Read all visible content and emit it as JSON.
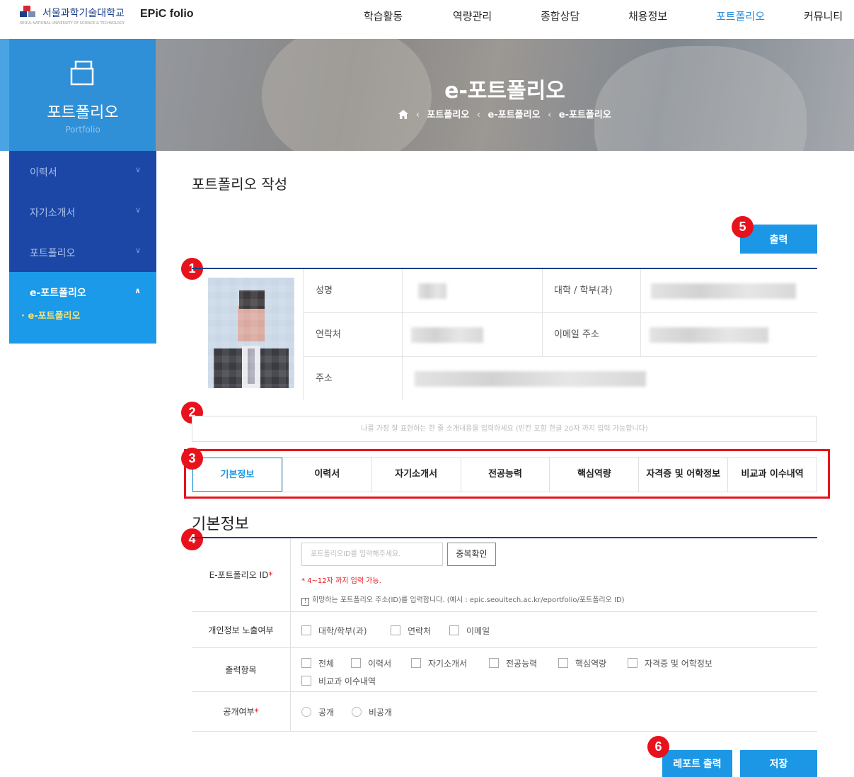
{
  "topnav": {
    "logo_text": "서울과학기술대학교",
    "logo_sub": "SEOUL NATIONAL UNIVERSITY OF SCIENCE & TECHNOLOGY",
    "brand": "EPiC folio",
    "menu": [
      "학습활동",
      "역량관리",
      "종합상담",
      "채용정보",
      "포트폴리오",
      "커뮤니티"
    ],
    "active_menu": "포트폴리오"
  },
  "sidebar": {
    "title": "포트폴리오",
    "subtitle": "Portfolio",
    "items": [
      {
        "label": "이력서"
      },
      {
        "label": "자기소개서"
      },
      {
        "label": "포트폴리오"
      },
      {
        "label": "e-포트폴리오",
        "sub": "· e-포트폴리오"
      }
    ]
  },
  "banner": {
    "title": "e-포트폴리오",
    "breadcrumb": [
      "포트폴리오",
      "e-포트폴리오",
      "e-포트폴리오"
    ]
  },
  "main": {
    "page_title": "포트폴리오 작성",
    "print_button": "출력",
    "badges": [
      "1",
      "2",
      "3",
      "4",
      "5",
      "6"
    ],
    "profile": {
      "name_label": "성명",
      "dept_label": "대학 / 학부(과)",
      "contact_label": "연락처",
      "email_label": "이메일 주소",
      "address_label": "주소"
    },
    "intro_placeholder": "나를 가장 잘 표현하는 한 줄 소개내용을 입력하세요 (빈칸 포함 한글 20자 까지 입력 가능합니다)",
    "tabs": [
      "기본정보",
      "이력서",
      "자기소개서",
      "전공능력",
      "핵심역량",
      "자격증 및 어학정보",
      "비교과 이수내역"
    ],
    "active_tab": "기본정보",
    "section_title": "기본정보",
    "form": {
      "id_label": "E-포트폴리오 ID",
      "id_placeholder": "포트폴리오ID를 입력해주세요.",
      "dup_button": "중복확인",
      "id_hint": "* 4~12자 까지 입력 가능.",
      "id_info_icon": "!",
      "id_info": "희망하는 포트폴리오 주소(ID)를 입력합니다. (예시 : epic.seoultech.ac.kr/eportfolio/포트폴리오 ID)",
      "privacy_label": "개인정보 노출여부",
      "privacy_options": [
        "대학/학부(과)",
        "연락처",
        "이메일"
      ],
      "output_label": "출력항목",
      "output_options": [
        "전체",
        "이력서",
        "자기소개서",
        "전공능력",
        "핵심역량",
        "자격증 및 어학정보",
        "비교과 이수내역"
      ],
      "public_label": "공개여부",
      "public_options": [
        "공개",
        "비공개"
      ],
      "required_mark": "*"
    },
    "report_button": "레포트 출력",
    "save_button": "저장"
  },
  "colors": {
    "accent": "#1b97e6",
    "navy": "#1d47a6",
    "highlight": "#e8121c"
  }
}
